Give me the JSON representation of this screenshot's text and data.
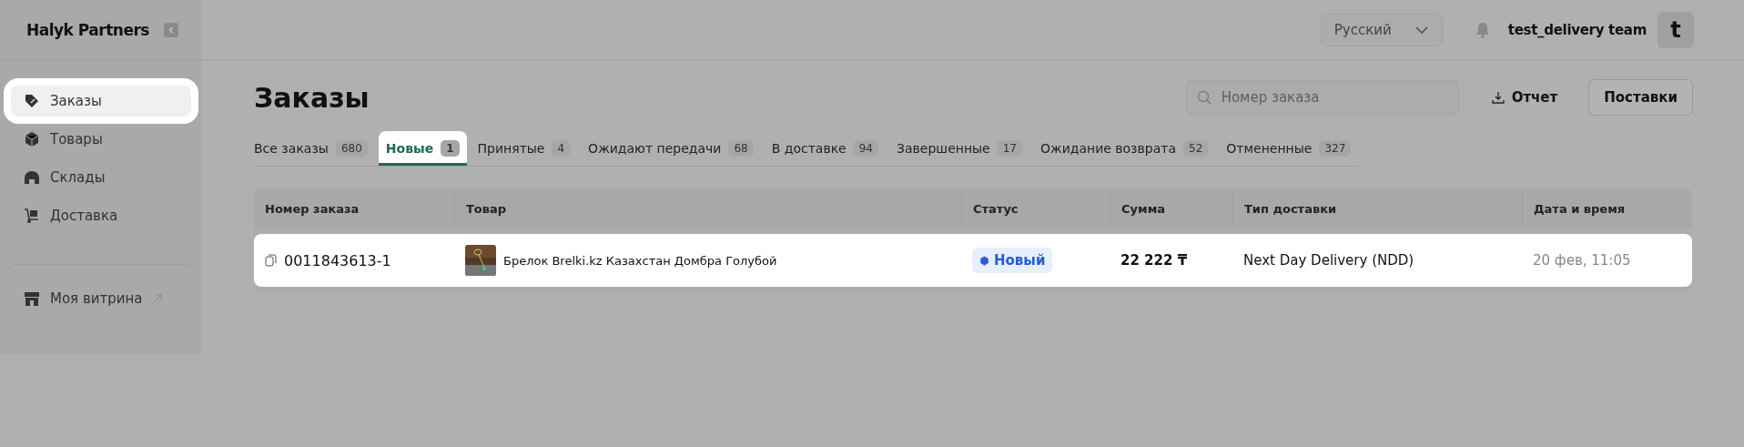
{
  "brand": "Halyk Partners",
  "nav": [
    {
      "label": "Заказы",
      "kind": "tag",
      "selected": true
    },
    {
      "label": "Товары",
      "kind": "box",
      "selected": false
    },
    {
      "label": "Склады",
      "kind": "warehouse",
      "selected": false
    },
    {
      "label": "Доставка",
      "kind": "cart",
      "selected": false
    }
  ],
  "storefront": {
    "label": "Моя витрина"
  },
  "header": {
    "language": "Русский",
    "user": "test_delivery team",
    "avatar": "t"
  },
  "page": {
    "title": "Заказы",
    "search": {
      "placeholder": "Номер заказа"
    },
    "report": "Отчет",
    "supplies": "Поставки"
  },
  "tabs": [
    {
      "label": "Все заказы",
      "count": "680",
      "selected": false
    },
    {
      "label": "Новые",
      "count": "1",
      "selected": true
    },
    {
      "label": "Принятые",
      "count": "4",
      "selected": false
    },
    {
      "label": "Ожидают передачи",
      "count": "68",
      "selected": false
    },
    {
      "label": "В доставке",
      "count": "94",
      "selected": false
    },
    {
      "label": "Завершенные",
      "count": "17",
      "selected": false
    },
    {
      "label": "Ожидание возврата",
      "count": "52",
      "selected": false
    },
    {
      "label": "Отмененные",
      "count": "327",
      "selected": false
    }
  ],
  "table": {
    "columns": [
      "Номер заказа",
      "Товар",
      "Статус",
      "Сумма",
      "Тип доставки",
      "Дата и время"
    ],
    "rows": [
      {
        "order": "0011843613-1",
        "product": "Брелок Brelki.kz Казахстан Домбра Голубой",
        "status": "Новый",
        "sum": "22 222 ₸",
        "delivery": "Next Day Delivery (NDD)",
        "date": "20 фев, 11:05",
        "highlighted": true
      }
    ]
  }
}
